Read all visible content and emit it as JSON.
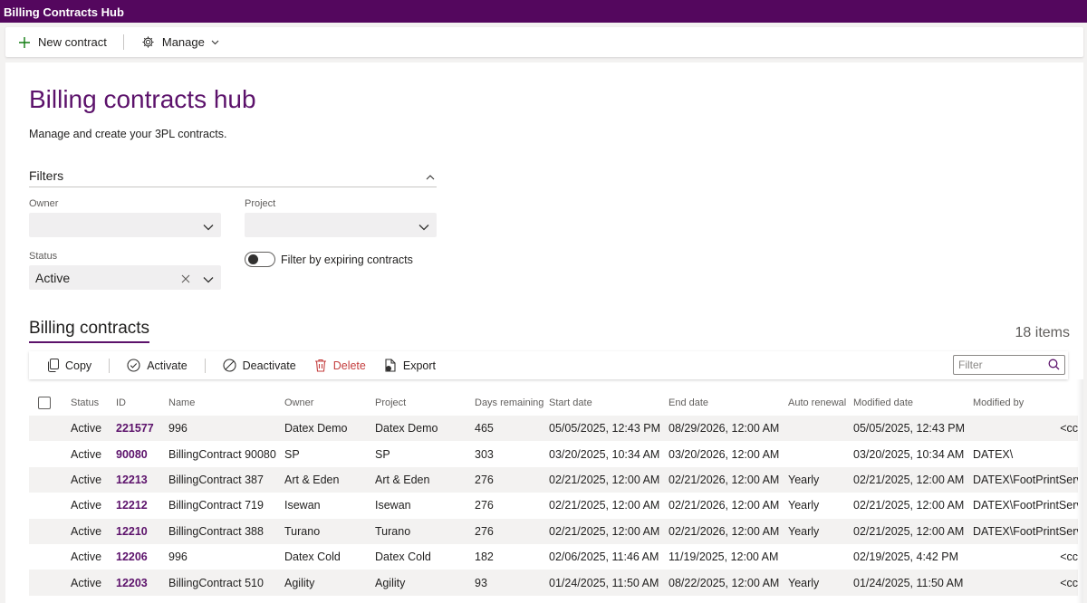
{
  "app": {
    "title": "Billing Contracts Hub"
  },
  "commandbar": {
    "new_label": "New contract",
    "manage_label": "Manage"
  },
  "page": {
    "title": "Billing contracts hub",
    "subtitle": "Manage and create your 3PL contracts."
  },
  "filters": {
    "heading": "Filters",
    "owner": {
      "label": "Owner",
      "value": ""
    },
    "project": {
      "label": "Project",
      "value": ""
    },
    "status": {
      "label": "Status",
      "value": "Active"
    },
    "expiring": {
      "label": "Filter by expiring contracts",
      "on": false
    }
  },
  "contracts": {
    "heading": "Billing contracts",
    "count": "18 items",
    "toolbar": {
      "copy": "Copy",
      "activate": "Activate",
      "deactivate": "Deactivate",
      "delete": "Delete",
      "export": "Export",
      "filter_placeholder": "Filter"
    },
    "columns": [
      "Status",
      "ID",
      "Name",
      "Owner",
      "Project",
      "Days remaining",
      "Start date",
      "End date",
      "Auto renewal",
      "Modified date",
      "Modified by"
    ],
    "rows": [
      [
        "Active",
        "221577",
        "996",
        "Datex Demo",
        "Datex Demo",
        "465",
        "05/05/2025, 12:43 PM",
        "08/29/2026, 12:00 AM",
        "",
        "05/05/2025, 12:43 PM",
        "<cc"
      ],
      [
        "Active",
        "90080",
        "BillingContract 90080",
        "SP",
        "SP",
        "303",
        "03/20/2025, 10:34 AM",
        "03/20/2026, 12:00 AM",
        "",
        "03/20/2025, 10:34 AM",
        "DATEX\\"
      ],
      [
        "Active",
        "12213",
        "BillingContract 387",
        "Art & Eden",
        "Art & Eden",
        "276",
        "02/21/2025, 12:00 AM",
        "02/21/2026, 12:00 AM",
        "Yearly",
        "02/21/2025, 12:00 AM",
        "DATEX\\FootPrintServ"
      ],
      [
        "Active",
        "12212",
        "BillingContract 719",
        "Isewan",
        "Isewan",
        "276",
        "02/21/2025, 12:00 AM",
        "02/21/2026, 12:00 AM",
        "Yearly",
        "02/21/2025, 12:00 AM",
        "DATEX\\FootPrintServ"
      ],
      [
        "Active",
        "12210",
        "BillingContract 388",
        "Turano",
        "Turano",
        "276",
        "02/21/2025, 12:00 AM",
        "02/21/2026, 12:00 AM",
        "Yearly",
        "02/21/2025, 12:00 AM",
        "DATEX\\FootPrintServ"
      ],
      [
        "Active",
        "12206",
        "996",
        "Datex Cold",
        "Datex Cold",
        "182",
        "02/06/2025, 11:46 AM",
        "11/19/2025, 12:00 AM",
        "",
        "02/19/2025, 4:42 PM",
        "<cc"
      ],
      [
        "Active",
        "12203",
        "BillingContract 510",
        "Agility",
        "Agility",
        "93",
        "01/24/2025, 11:50 AM",
        "08/22/2025, 12:00 AM",
        "Yearly",
        "01/24/2025, 11:50 AM",
        "<cc"
      ]
    ]
  }
}
